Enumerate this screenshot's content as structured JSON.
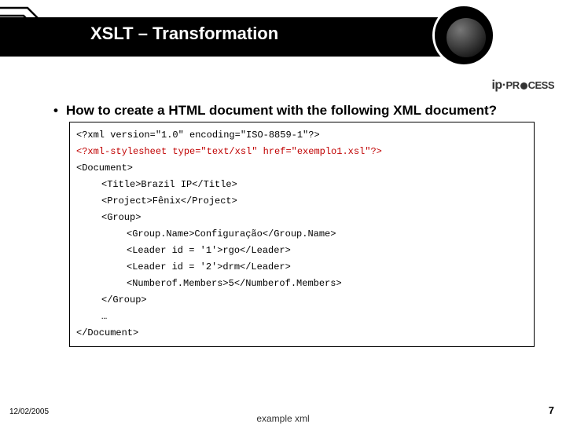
{
  "header": {
    "title": "XSLT – Transformation",
    "logo": "ip·PROCESS"
  },
  "content": {
    "bullet": "•",
    "question": "How to create a HTML document with the following XML document?",
    "code": {
      "l1": "<?xml version=\"1.0\" encoding=\"ISO-8859-1\"?>",
      "l2": "<?xml-stylesheet type=\"text/xsl\" href=\"exemplo1.xsl\"?>",
      "l3": "<Document>",
      "l4": "<Title>Brazil IP</Title>",
      "l5": "<Project>Fênix</Project>",
      "l6": "<Group>",
      "l7": "<Group.Name>Configuração</Group.Name>",
      "l8": "<Leader id = '1'>rgo</Leader>",
      "l9": "<Leader id = '2'>drm</Leader>",
      "l10": "<Numberof.Members>5</Numberof.Members>",
      "l11": "</Group>",
      "l12": "…",
      "l13": "</Document>"
    }
  },
  "footer": {
    "date": "12/02/2005",
    "caption": "example xml",
    "page": "7"
  }
}
